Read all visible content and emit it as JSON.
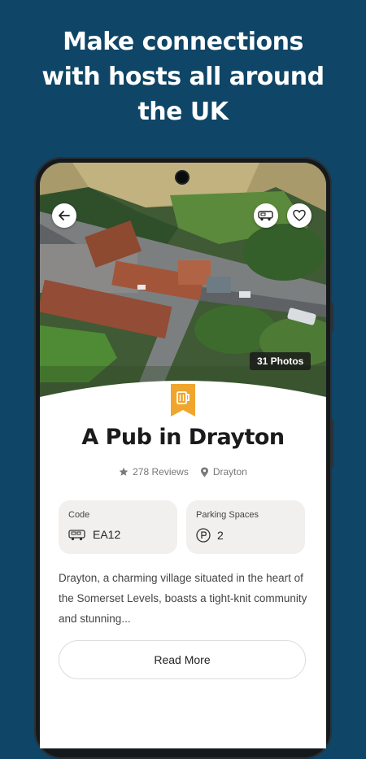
{
  "promo": {
    "headline_line1": "Make connections",
    "headline_line2": "with hosts all around",
    "headline_line3": "the UK"
  },
  "listing": {
    "photos_badge": "31 Photos",
    "title": "A Pub in Drayton",
    "reviews": "278 Reviews",
    "location": "Drayton",
    "code_label": "Code",
    "code_value": "EA12",
    "parking_label": "Parking Spaces",
    "parking_value": "2",
    "description": "Drayton, a charming village situated in the heart of the Somerset Levels, boasts a tight-knit community and stunning...",
    "read_more": "Read More"
  },
  "icons": [
    "back-arrow-icon",
    "campervan-icon",
    "heart-icon",
    "pub-mug-icon",
    "star-icon",
    "location-pin-icon",
    "parking-icon"
  ],
  "colors": {
    "background": "#0f4566",
    "accent": "#f0a52d",
    "card": "#f2f0ef"
  }
}
